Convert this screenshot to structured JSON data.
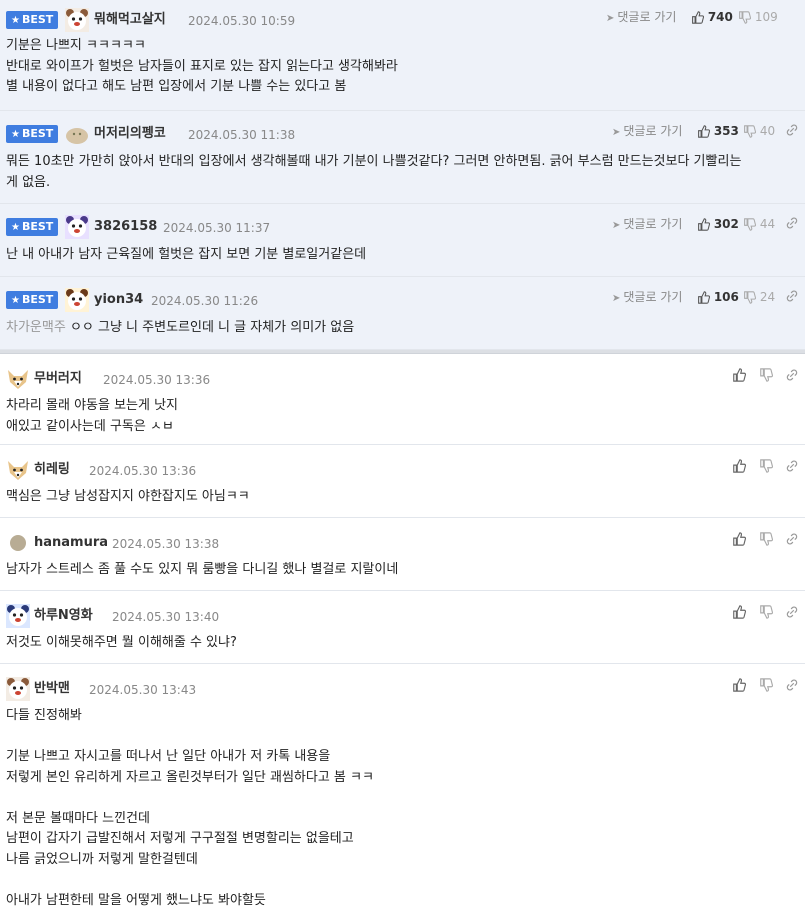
{
  "labels": {
    "best": "BEST",
    "reply_link": "댓글로 가기"
  },
  "best_comments": [
    {
      "nick": "뭐해먹고살지",
      "date": "2024.05.30 10:59",
      "up": "740",
      "down": "109",
      "avatar": "dog-face-avatar",
      "lines": [
        "기분은 나쁘지 ㅋㅋㅋㅋㅋ",
        "반대로 와이프가 헐벗은 남자들이 표지로 있는 잡지 읽는다고 생각해봐라",
        "별 내용이 없다고 해도 남편 입장에서 기분 나쁠 수는 있다고 봄"
      ]
    },
    {
      "nick": "머저리의펭코",
      "date": "2024.05.30 11:38",
      "up": "353",
      "down": "40",
      "avatar": "round-blob-avatar",
      "lines": [
        "뭐든 10초만 가만히 앉아서 반대의 입장에서 생각해볼때 내가 기분이 나쁠것같다? 그러면 안하면됨. 긁어 부스럼 만드는것보다 기빨리는",
        "게 없음."
      ]
    },
    {
      "nick": "3826158",
      "date": "2024.05.30 11:37",
      "up": "302",
      "down": "44",
      "avatar": "dog-face-avatar",
      "lines": [
        "난 내 아내가 남자 근육질에 헐벗은 잡지 보면 기분 별로일거같은데"
      ]
    },
    {
      "nick": "yion34",
      "date": "2024.05.30 11:26",
      "up": "106",
      "down": "24",
      "avatar": "dog-face-avatar",
      "mute_prefix": "차가운맥주",
      "lines": [
        "ㅇㅇ 그냥 니 주변도르인데 니 글 자체가 의미가 없음"
      ]
    }
  ],
  "comments": [
    {
      "nick": "무버러지",
      "date": "2024.05.30 13:36",
      "avatar": "fox-avatar",
      "lines": [
        "차라리 몰래 야동을 보는게 낫지",
        "애있고 같이사는데 구독은 ㅅㅂ"
      ]
    },
    {
      "nick": "히레링",
      "date": "2024.05.30 13:36",
      "avatar": "fox-avatar",
      "lines": [
        "맥심은 그냥 남성잡지지 야한잡지도 아님ㅋㅋ"
      ]
    },
    {
      "nick": "hanamura",
      "date": "2024.05.30 13:38",
      "avatar": "dot-avatar",
      "lines": [
        "남자가 스트레스 좀 풀 수도 있지 뭐 룸빵을 다니길 했나 별걸로 지랄이네"
      ]
    },
    {
      "nick": "하루N영화",
      "date": "2024.05.30 13:40",
      "avatar": "dog-face-avatar",
      "lines": [
        "저것도 이해못해주면 뭘 이해해줄 수 있냐?"
      ]
    },
    {
      "nick": "반박맨",
      "date": "2024.05.30 13:43",
      "avatar": "dog-face-avatar",
      "lines": [
        "다들 진정해봐",
        "",
        "기분 나쁘고 자시고를 떠나서 난 일단 아내가 저 카톡 내용을",
        "저렇게 본인 유리하게 자르고 올린것부터가 일단 괘씸하다고 봄 ㅋㅋ",
        "",
        "저 본문 볼때마다 느낀건데",
        "남편이 갑자기 급발진해서 저렇게 구구절절 변명할리는 없을테고",
        "나름 긁었으니까 저렇게 말한걸텐데",
        "",
        "아내가 남편한테 말을 어떻게 했느냐도 봐야할듯"
      ]
    }
  ]
}
